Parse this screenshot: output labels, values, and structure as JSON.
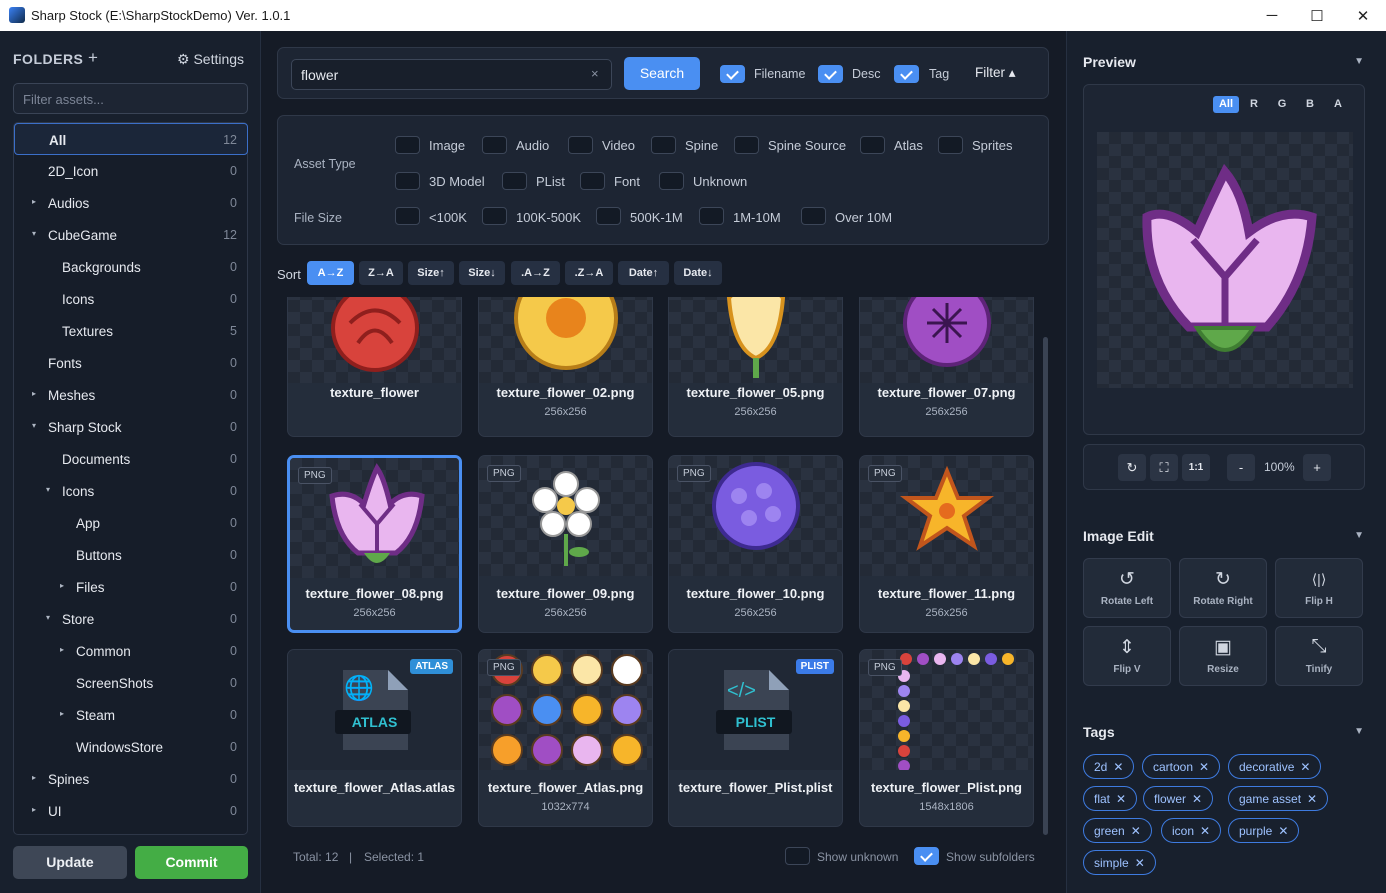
{
  "window": {
    "title": "Sharp Stock (E:\\SharpStockDemo) Ver. 1.0.1",
    "minimize": "─",
    "maximize": "☐",
    "close": "✕"
  },
  "folders": {
    "header": "FOLDERS",
    "add": "+",
    "settings": "⚙ Settings",
    "filter_placeholder": "Filter assets...",
    "items": [
      {
        "label": "All",
        "count": "12",
        "arrow": ""
      },
      {
        "label": "2D_Icon",
        "count": "0",
        "arrow": ""
      },
      {
        "label": "Audios",
        "count": "0",
        "arrow": "▸"
      },
      {
        "label": "CubeGame",
        "count": "12",
        "arrow": "▾"
      },
      {
        "label": "Backgrounds",
        "count": "0",
        "arrow": ""
      },
      {
        "label": "Icons",
        "count": "0",
        "arrow": ""
      },
      {
        "label": "Textures",
        "count": "5",
        "arrow": ""
      },
      {
        "label": "Fonts",
        "count": "0",
        "arrow": ""
      },
      {
        "label": "Meshes",
        "count": "0",
        "arrow": "▸"
      },
      {
        "label": "Sharp Stock",
        "count": "0",
        "arrow": "▾"
      },
      {
        "label": "Documents",
        "count": "0",
        "arrow": ""
      },
      {
        "label": "Icons",
        "count": "0",
        "arrow": "▾"
      },
      {
        "label": "App",
        "count": "0",
        "arrow": ""
      },
      {
        "label": "Buttons",
        "count": "0",
        "arrow": ""
      },
      {
        "label": "Files",
        "count": "0",
        "arrow": "▸"
      },
      {
        "label": "Store",
        "count": "0",
        "arrow": "▾"
      },
      {
        "label": "Common",
        "count": "0",
        "arrow": "▸"
      },
      {
        "label": "ScreenShots",
        "count": "0",
        "arrow": ""
      },
      {
        "label": "Steam",
        "count": "0",
        "arrow": "▸"
      },
      {
        "label": "WindowsStore",
        "count": "0",
        "arrow": ""
      },
      {
        "label": "Spines",
        "count": "0",
        "arrow": "▸"
      },
      {
        "label": "UI",
        "count": "0",
        "arrow": "▸"
      }
    ],
    "update": "Update",
    "commit": "Commit"
  },
  "search": {
    "query": "flower",
    "clear": "×",
    "button": "Search",
    "filename": "Filename",
    "desc": "Desc",
    "tag": "Tag",
    "filter": "Filter ▴"
  },
  "filters": {
    "asset_type_label": "Asset Type",
    "types": [
      "Image",
      "Audio",
      "Video",
      "Spine",
      "Spine Source",
      "Atlas",
      "Sprites",
      "3D Model",
      "PList",
      "Font",
      "Unknown"
    ],
    "file_size_label": "File Size",
    "sizes": [
      "<100K",
      "100K-500K",
      "500K-1M",
      "1M-10M",
      "Over 10M"
    ]
  },
  "sort": {
    "label": "Sort",
    "options": [
      "A→Z",
      "Z→A",
      "Size↑",
      "Size↓",
      ".A→Z",
      ".Z→A",
      "Date↑",
      "Date↓"
    ]
  },
  "assets": [
    {
      "name": "texture_flower",
      "dim": "",
      "badge": ""
    },
    {
      "name": "texture_flower_02.png",
      "dim": "256x256",
      "badge": ""
    },
    {
      "name": "texture_flower_05.png",
      "dim": "256x256",
      "badge": ""
    },
    {
      "name": "texture_flower_07.png",
      "dim": "256x256",
      "badge": ""
    },
    {
      "name": "texture_flower_08.png",
      "dim": "256x256",
      "badge": "PNG"
    },
    {
      "name": "texture_flower_09.png",
      "dim": "256x256",
      "badge": "PNG"
    },
    {
      "name": "texture_flower_10.png",
      "dim": "256x256",
      "badge": "PNG"
    },
    {
      "name": "texture_flower_11.png",
      "dim": "256x256",
      "badge": "PNG"
    },
    {
      "name": "texture_flower_Atlas.atlas",
      "dim": "",
      "badge": "ATLAS",
      "icon_text": "ATLAS"
    },
    {
      "name": "texture_flower_Atlas.png",
      "dim": "1032x774",
      "badge": "PNG"
    },
    {
      "name": "texture_flower_Plist.plist",
      "dim": "",
      "badge": "PLIST",
      "icon_text": "PLIST"
    },
    {
      "name": "texture_flower_Plist.png",
      "dim": "1548x1806",
      "badge": "PNG"
    }
  ],
  "status": {
    "total": "Total: 12",
    "sep": "|",
    "selected": "Selected: 1",
    "show_unknown": "Show unknown",
    "show_subfolders": "Show subfolders"
  },
  "preview": {
    "header": "Preview",
    "channels": [
      "All",
      "R",
      "G",
      "B",
      "A"
    ],
    "zoom": "100%",
    "fit": "1:1",
    "minus": "-",
    "plus": "+"
  },
  "image_edit": {
    "header": "Image Edit",
    "buttons": [
      "Rotate Left",
      "Rotate Right",
      "Flip H",
      "Flip V",
      "Resize",
      "Tinify"
    ]
  },
  "tags": {
    "header": "Tags",
    "items": [
      "2d",
      "cartoon",
      "decorative",
      "flat",
      "flower",
      "game asset",
      "green",
      "icon",
      "purple",
      "simple"
    ]
  },
  "colors": {
    "accent": "#4a8ff2",
    "commit": "#44ad45",
    "bg": "#151b26"
  }
}
